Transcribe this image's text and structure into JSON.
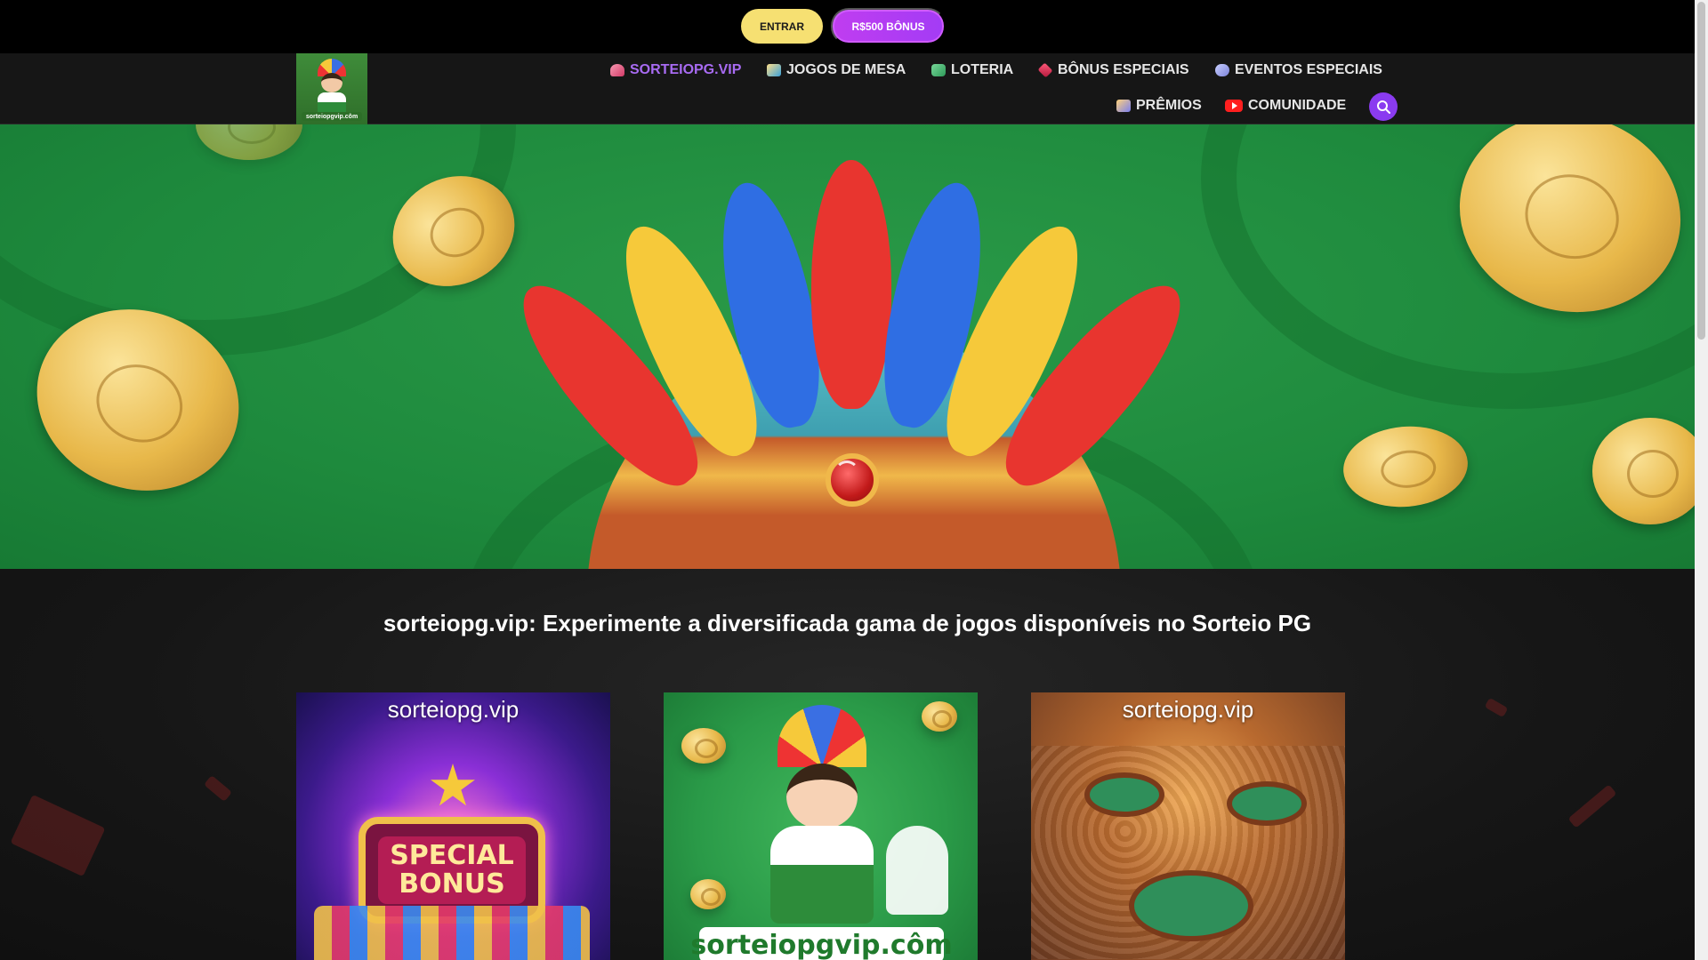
{
  "topbar": {
    "login_label": "ENTRAR",
    "bonus_label": "R$500 BÔNUS"
  },
  "nav": {
    "items": [
      {
        "label": "SORTEIOPG.VIP",
        "icon": "home-icon",
        "active": true
      },
      {
        "label": "JOGOS DE MESA",
        "icon": "table-games-icon"
      },
      {
        "label": "LOTERIA",
        "icon": "lottery-icon"
      },
      {
        "label": "BÔNUS ESPECIAIS",
        "icon": "gift-box-icon"
      },
      {
        "label": "EVENTOS ESPECIAIS",
        "icon": "gamepad-icon"
      },
      {
        "label": "PRÊMIOS",
        "icon": "award-icon"
      },
      {
        "label": "COMUNIDADE",
        "icon": "youtube-icon"
      }
    ],
    "active_color": "#a86bf2",
    "search_color": "#8a3bf0"
  },
  "main": {
    "headline": "sorteiopg.vip: Experimente a diversificada gama de jogos disponíveis no Sorteio PG",
    "cards": [
      {
        "caption": "sorteiopg.vip",
        "image_text": [
          "SPECIAL",
          "BONUS"
        ]
      },
      {
        "caption": "",
        "image_text": [
          "sorteiopgvip.côm"
        ]
      },
      {
        "caption": "sorteiopg.vip",
        "image_text": []
      }
    ]
  },
  "colors": {
    "entrar_bg": "#f6e072",
    "bonus_bg": "#c03df0",
    "hero_green": "#1e8a3d"
  }
}
